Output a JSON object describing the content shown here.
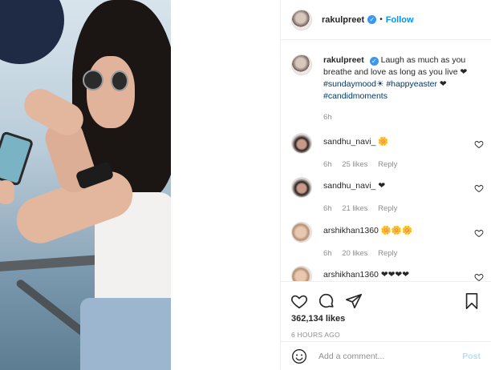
{
  "post": {
    "username": "rakulpreet",
    "follow_label": "Follow",
    "separator": "•",
    "caption_text": "Laugh as much as you breathe and love as long as you live",
    "caption_heart": "❤",
    "tag_sundaymood": "#sundaymood",
    "sparkle": "☀",
    "tag_happyeaster": "#happyeaster",
    "caption_heart2": "❤",
    "tag_candid": "#candidmoments",
    "caption_time": "6h"
  },
  "comments": [
    {
      "username": "sandhu_navi_",
      "text": "🌼",
      "time": "6h",
      "likes": "25 likes",
      "reply": "Reply"
    },
    {
      "username": "sandhu_navi_",
      "text": "❤",
      "time": "6h",
      "likes": "21 likes",
      "reply": "Reply"
    },
    {
      "username": "arshikhan1360",
      "text": "🌼🌼🌼",
      "time": "6h",
      "likes": "20 likes",
      "reply": "Reply"
    },
    {
      "username": "arshikhan1360",
      "text": "❤❤❤❤",
      "time": "",
      "likes": "",
      "reply": ""
    }
  ],
  "actions": {
    "likes_count": "362,134 likes",
    "posted_ago": "6 HOURS AGO"
  },
  "composer": {
    "placeholder": "Add a comment...",
    "post_label": "Post"
  },
  "colors": {
    "accent": "#0095f6",
    "verified": "#3897f0",
    "muted": "#8e8e8e",
    "hashtag": "#00376b"
  }
}
